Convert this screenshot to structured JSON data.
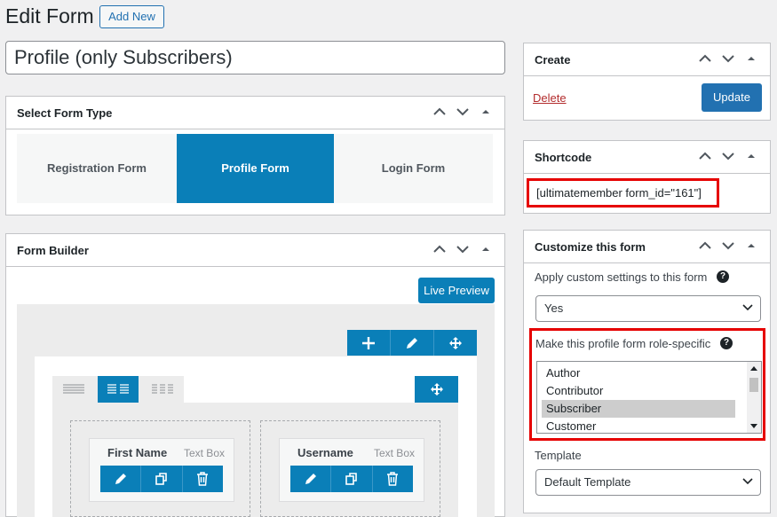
{
  "header": {
    "title": "Edit Form",
    "add_new_label": "Add New"
  },
  "form_title_value": "Profile (only Subscribers)",
  "form_type_box": {
    "title": "Select Form Type",
    "tabs": [
      {
        "label": "Registration Form"
      },
      {
        "label": "Profile Form"
      },
      {
        "label": "Login Form"
      }
    ],
    "selected": "Profile Form"
  },
  "builder_box": {
    "title": "Form Builder",
    "live_preview_label": "Live Preview",
    "fields": [
      {
        "name": "First Name",
        "type": "Text Box"
      },
      {
        "name": "Username",
        "type": "Text Box"
      }
    ]
  },
  "create_box": {
    "title": "Create",
    "delete_label": "Delete",
    "update_label": "Update"
  },
  "shortcode_box": {
    "title": "Shortcode",
    "shortcode": "[ultimatemember form_id=\"161\"]"
  },
  "customize_box": {
    "title": "Customize this form",
    "apply_label": "Apply custom settings to this form",
    "apply_value": "Yes",
    "role_label": "Make this profile form role-specific",
    "roles": [
      "Author",
      "Contributor",
      "Subscriber",
      "Customer"
    ],
    "selected_role": "Subscriber",
    "template_label": "Template",
    "template_value": "Default Template"
  },
  "colors": {
    "accent": "#0a7fb8",
    "button": "#2271b1",
    "highlight": "#e60000",
    "delete": "#b32d2e"
  }
}
